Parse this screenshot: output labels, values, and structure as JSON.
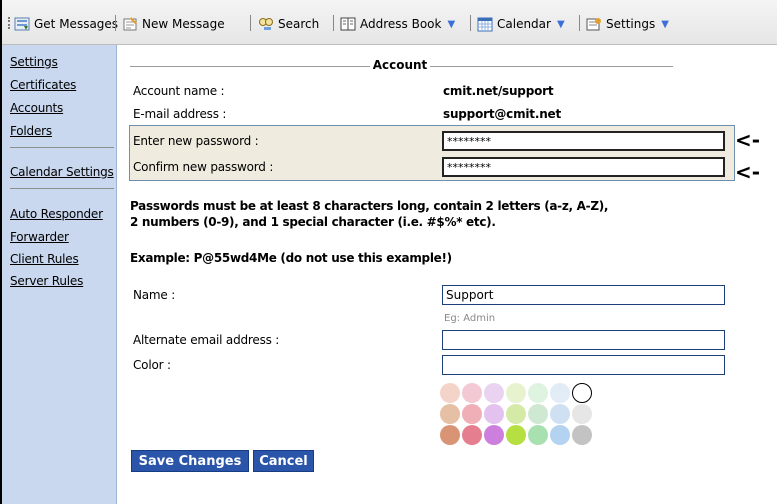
{
  "toolbar": {
    "items": [
      {
        "label": "Get Messages",
        "icon": "get-messages-icon"
      },
      {
        "label": "New Message",
        "icon": "new-message-icon"
      },
      {
        "label": "Search",
        "icon": "search-icon"
      },
      {
        "label": "Address Book",
        "icon": "address-book-icon"
      },
      {
        "label": "Calendar",
        "icon": "calendar-icon"
      },
      {
        "label": "Settings",
        "icon": "settings-icon"
      }
    ]
  },
  "sidebar": {
    "group1": [
      "Settings",
      "Certificates",
      "Accounts",
      "Folders"
    ],
    "group2": [
      "Calendar Settings"
    ],
    "group3": [
      "Auto Responder",
      "Forwarder",
      "Client Rules",
      "Server Rules"
    ]
  },
  "account": {
    "legend": "Account",
    "account_name_label": "Account name :",
    "account_name": "cmit.net/support",
    "email_label": "E-mail address :",
    "email": "support@cmit.net",
    "new_password_label": "Enter new password :",
    "new_password_value": "********",
    "confirm_password_label": "Confirm new password :",
    "confirm_password_value": "********",
    "arrow": "<-",
    "policy_line1": "Passwords must be at least 8 characters long, contain 2 letters (a-z, A-Z),",
    "policy_line2": "2 numbers (0-9), and 1 special character (i.e. #$%* etc).",
    "example": "Example: P@55wd4Me (do not use this example!)",
    "name_label": "Name :",
    "name_value": "Support",
    "name_hint": "Eg: Admin",
    "alt_email_label": "Alternate email address :",
    "alt_email_value": "",
    "color_label": "Color :",
    "color_value": ""
  },
  "colors": {
    "rows": [
      [
        "#f4d3c9",
        "#f3c9d3",
        "#ead3f1",
        "#e7f3cf",
        "#dff3e1",
        "#e2ecf7",
        "selected"
      ],
      [
        "#e6c0a4",
        "#f0aeb6",
        "#e4c2ef",
        "#d5eaa7",
        "#cfe8d2",
        "#cfe0f3",
        "#e6e6e6"
      ],
      [
        "#d99475",
        "#e57f8f",
        "#cc7fdc",
        "#b6df41",
        "#a9e0b0",
        "#b3d3f0",
        "#c3c3c3"
      ]
    ]
  },
  "buttons": {
    "save": "Save Changes",
    "cancel": "Cancel"
  }
}
